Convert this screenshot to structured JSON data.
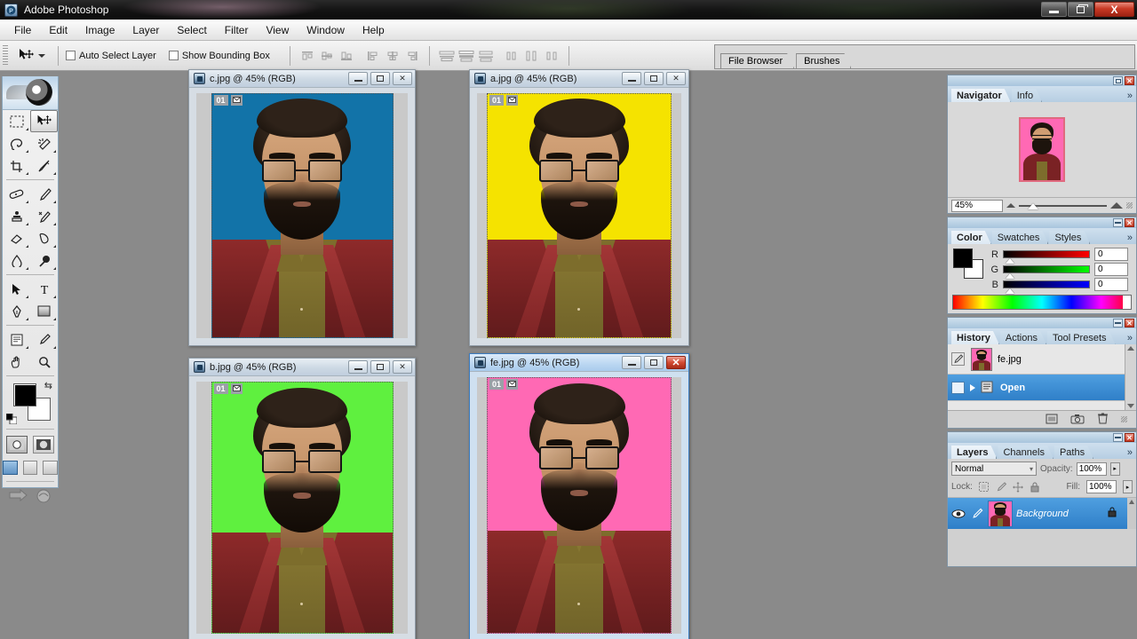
{
  "window": {
    "app_title": "Adobe Photoshop",
    "logo_icon": "photoshop-logo-icon",
    "minimize_label": "Minimize",
    "restore_label": "Restore",
    "close_label": "X"
  },
  "menubar": {
    "items": [
      {
        "label": "File"
      },
      {
        "label": "Edit"
      },
      {
        "label": "Image"
      },
      {
        "label": "Layer"
      },
      {
        "label": "Select"
      },
      {
        "label": "Filter"
      },
      {
        "label": "View"
      },
      {
        "label": "Window"
      },
      {
        "label": "Help"
      }
    ]
  },
  "options_bar": {
    "tool_icon": "move-tool-icon",
    "auto_select_layer": {
      "label": "Auto Select Layer",
      "checked": false
    },
    "show_bounding_box": {
      "label": "Show Bounding Box",
      "checked": false
    },
    "align_buttons": [
      "align-top-edges-icon",
      "align-vertical-centers-icon",
      "align-bottom-edges-icon",
      "align-left-edges-icon",
      "align-horizontal-centers-icon",
      "align-right-edges-icon",
      "distribute-top-edges-icon",
      "distribute-vertical-centers-icon",
      "distribute-bottom-edges-icon",
      "distribute-left-edges-icon",
      "distribute-horizontal-centers-icon",
      "distribute-right-edges-icon"
    ]
  },
  "palette_well": {
    "tabs": [
      {
        "label": "File Browser"
      },
      {
        "label": "Brushes"
      }
    ]
  },
  "toolbox": {
    "tools": [
      {
        "name": "rectangular-marquee-tool",
        "selected": false
      },
      {
        "name": "move-tool",
        "selected": true
      },
      {
        "name": "lasso-tool",
        "selected": false
      },
      {
        "name": "magic-wand-tool",
        "selected": false
      },
      {
        "name": "crop-tool",
        "selected": false
      },
      {
        "name": "slice-tool",
        "selected": false
      },
      {
        "name": "healing-brush-tool",
        "selected": false
      },
      {
        "name": "brush-tool",
        "selected": false
      },
      {
        "name": "clone-stamp-tool",
        "selected": false
      },
      {
        "name": "history-brush-tool",
        "selected": false
      },
      {
        "name": "eraser-tool",
        "selected": false
      },
      {
        "name": "gradient-tool",
        "selected": false
      },
      {
        "name": "blur-tool",
        "selected": false
      },
      {
        "name": "dodge-tool",
        "selected": false
      },
      {
        "name": "path-selection-tool",
        "selected": false
      },
      {
        "name": "type-tool",
        "selected": false
      },
      {
        "name": "pen-tool",
        "selected": false
      },
      {
        "name": "rectangle-tool",
        "selected": false
      },
      {
        "name": "notes-tool",
        "selected": false
      },
      {
        "name": "eyedropper-tool",
        "selected": false
      },
      {
        "name": "hand-tool",
        "selected": false
      },
      {
        "name": "zoom-tool",
        "selected": false
      }
    ],
    "foreground_color": "#000000",
    "background_color": "#ffffff",
    "swap_colors_icon": "swap-colors-icon",
    "default_colors_icon": "default-colors-icon",
    "quick_mask": [
      "standard-mode-icon",
      "quick-mask-mode-icon"
    ],
    "screen_modes": [
      "standard-screen-mode-icon",
      "full-screen-with-menubar-icon",
      "full-screen-mode-icon"
    ],
    "jump_to": [
      "jump-to-imageready-icon",
      "jump-to-imageready-alt-icon"
    ]
  },
  "documents": [
    {
      "title": "c.jpg @ 45% (RGB)",
      "filename": "c.jpg",
      "zoom": "45%",
      "mode": "RGB",
      "active": false,
      "bg_color": "#1273a8",
      "tag_number": "01",
      "tag_icon": "image-tag-icon",
      "buttons": [
        "minimize",
        "restore",
        "close"
      ]
    },
    {
      "title": "a.jpg @ 45% (RGB)",
      "filename": "a.jpg",
      "zoom": "45%",
      "mode": "RGB",
      "active": false,
      "bg_color": "#f5e300",
      "tag_number": "01",
      "tag_icon": "image-tag-icon",
      "buttons": [
        "minimize",
        "restore",
        "close"
      ]
    },
    {
      "title": "b.jpg @ 45% (RGB)",
      "filename": "b.jpg",
      "zoom": "45%",
      "mode": "RGB",
      "active": false,
      "bg_color": "#5ff03f",
      "tag_number": "01",
      "tag_icon": "image-tag-icon",
      "buttons": [
        "minimize",
        "restore",
        "close"
      ]
    },
    {
      "title": "fe.jpg @ 45% (RGB)",
      "filename": "fe.jpg",
      "zoom": "45%",
      "mode": "RGB",
      "active": true,
      "bg_color": "#ff69b4",
      "tag_number": "01",
      "tag_icon": "image-tag-icon",
      "buttons": [
        "minimize",
        "restore",
        "close"
      ]
    }
  ],
  "navigator_panel": {
    "tabs": [
      {
        "label": "Navigator",
        "active": true
      },
      {
        "label": "Info",
        "active": false
      }
    ],
    "more_icon": "panel-menu-icon",
    "zoom_value": "45%",
    "thumb_bg_color": "#ff69b4",
    "view_box_color": "#e06a7f",
    "zoom_out_icon": "zoom-out-icon",
    "zoom_in_icon": "zoom-in-icon"
  },
  "color_panel": {
    "tabs": [
      {
        "label": "Color",
        "active": true
      },
      {
        "label": "Swatches",
        "active": false
      },
      {
        "label": "Styles",
        "active": false
      }
    ],
    "more_icon": "panel-menu-icon",
    "foreground_color": "#000000",
    "background_color": "#ffffff",
    "channels": [
      {
        "label": "R",
        "value": "0",
        "ramp_from": "#000000",
        "ramp_to": "#ff0000"
      },
      {
        "label": "G",
        "value": "0",
        "ramp_from": "#000000",
        "ramp_to": "#00ff00"
      },
      {
        "label": "B",
        "value": "0",
        "ramp_from": "#000000",
        "ramp_to": "#0000ff"
      }
    ]
  },
  "history_panel": {
    "tabs": [
      {
        "label": "History",
        "active": true
      },
      {
        "label": "Actions",
        "active": false
      },
      {
        "label": "Tool Presets",
        "active": false
      }
    ],
    "more_icon": "panel-menu-icon",
    "snapshot": {
      "label": "fe.jpg",
      "thumb_bg_color": "#ff69b4"
    },
    "states": [
      {
        "label": "Open",
        "selected": true,
        "icon": "open-document-icon"
      }
    ],
    "footer_buttons": [
      "create-document-from-state-icon",
      "create-new-snapshot-icon",
      "delete-state-icon"
    ]
  },
  "layers_panel": {
    "tabs": [
      {
        "label": "Layers",
        "active": true
      },
      {
        "label": "Channels",
        "active": false
      },
      {
        "label": "Paths",
        "active": false
      }
    ],
    "more_icon": "panel-menu-icon",
    "blend_mode": "Normal",
    "opacity_label": "Opacity:",
    "opacity_value": "100%",
    "lock_label": "Lock:",
    "fill_label": "Fill:",
    "fill_value": "100%",
    "lock_icons": [
      "lock-transparent-pixels-icon",
      "lock-image-pixels-icon",
      "lock-position-icon",
      "lock-all-icon"
    ],
    "layers": [
      {
        "name": "Background",
        "selected": true,
        "visible": true,
        "locked": true,
        "thumb_bg_color": "#ff69b4",
        "eye_icon": "eye-icon",
        "link_icon": "brush-icon",
        "lock_icon": "lock-icon"
      }
    ]
  }
}
